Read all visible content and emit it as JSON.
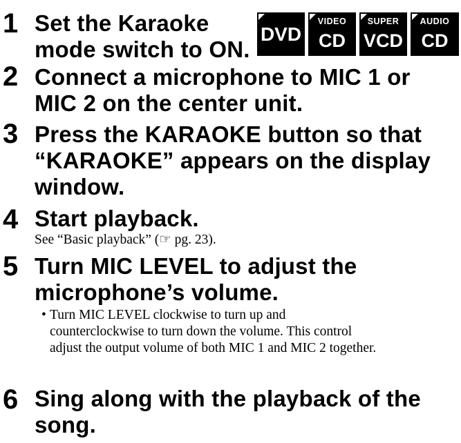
{
  "steps": [
    {
      "number": "1",
      "lines": [
        "Set the Karaoke",
        "mode switch to ON."
      ]
    },
    {
      "number": "2",
      "lines": [
        "Connect a microphone to MIC 1 or",
        "MIC 2 on the center unit."
      ]
    },
    {
      "number": "3",
      "lines": [
        "Press the KARAOKE button so that",
        "“KARAOKE” appears on the display",
        "window."
      ]
    },
    {
      "number": "4",
      "lines": [
        "Start playback."
      ],
      "sub": "See “Basic playback” (☞ pg. 23)."
    },
    {
      "number": "5",
      "lines": [
        "Turn MIC LEVEL to adjust the",
        "microphone’s volume."
      ],
      "bullet": {
        "mark": "•",
        "lines": [
          "Turn MIC LEVEL clockwise to turn up and",
          "counterclockwise to turn down the volume. This control",
          "adjust the output volume of both MIC 1 and MIC 2 together."
        ]
      }
    },
    {
      "number": "6",
      "lines": [
        "Sing along with the playback of the",
        "song."
      ]
    }
  ],
  "disc_badges": [
    {
      "small": "",
      "big": "DVD"
    },
    {
      "small": "VIDEO",
      "big": "CD"
    },
    {
      "small": "SUPER",
      "big": "VCD"
    },
    {
      "small": "AUDIO",
      "big": "CD"
    }
  ]
}
